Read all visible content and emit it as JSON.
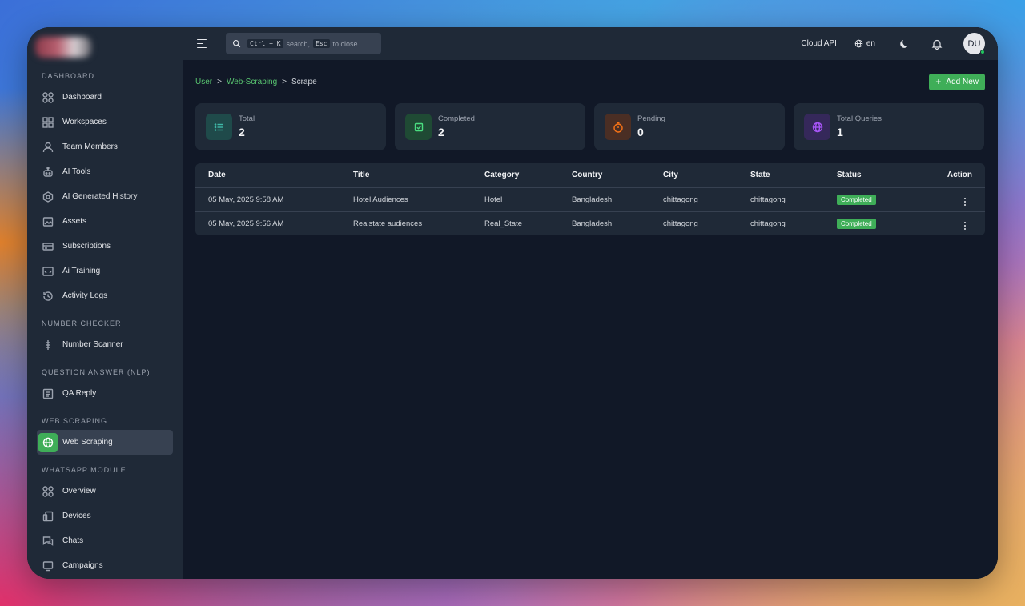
{
  "topbar": {
    "search_kbd1": "Ctrl + K",
    "search_text1": "search,",
    "search_kbd2": "Esc",
    "search_text2": "to close",
    "cloud_api": "Cloud API",
    "language": "en",
    "avatar_initials": "DU"
  },
  "sidebar": {
    "sections": {
      "dashboard": "DASHBOARD",
      "number_checker": "NUMBER CHECKER",
      "qa": "QUESTION ANSWER (NLP)",
      "web_scraping": "WEB SCRAPING",
      "whatsapp": "WHATSAPP MODULE"
    },
    "items": {
      "dashboard": "Dashboard",
      "workspaces": "Workspaces",
      "team_members": "Team Members",
      "ai_tools": "AI Tools",
      "ai_history": "AI Generated History",
      "assets": "Assets",
      "subscriptions": "Subscriptions",
      "ai_training": "Ai Training",
      "activity_logs": "Activity Logs",
      "number_scanner": "Number Scanner",
      "qa_reply": "QA Reply",
      "web_scraping": "Web Scraping",
      "overview": "Overview",
      "devices": "Devices",
      "chats": "Chats",
      "campaigns": "Campaigns"
    }
  },
  "breadcrumb": {
    "user": "User",
    "web_scraping": "Web-Scraping",
    "current": "Scrape",
    "sep": ">"
  },
  "add_button": "Add New",
  "stats": [
    {
      "label": "Total",
      "value": "2"
    },
    {
      "label": "Completed",
      "value": "2"
    },
    {
      "label": "Pending",
      "value": "0"
    },
    {
      "label": "Total Queries",
      "value": "1"
    }
  ],
  "table": {
    "headers": [
      "Date",
      "Title",
      "Category",
      "Country",
      "City",
      "State",
      "Status",
      "Action"
    ],
    "rows": [
      {
        "date": "05 May, 2025 9:58 AM",
        "title": "Hotel Audiences",
        "category": "Hotel",
        "country": "Bangladesh",
        "city": "chittagong",
        "state": "chittagong",
        "status": "Completed"
      },
      {
        "date": "05 May, 2025 9:56 AM",
        "title": "Realstate audiences",
        "category": "Real_State",
        "country": "Bangladesh",
        "city": "chittagong",
        "state": "chittagong",
        "status": "Completed"
      }
    ]
  },
  "colors": {
    "accent_green": "#3fae58",
    "sidebar_bg": "#1f2937",
    "main_bg": "#111827"
  }
}
